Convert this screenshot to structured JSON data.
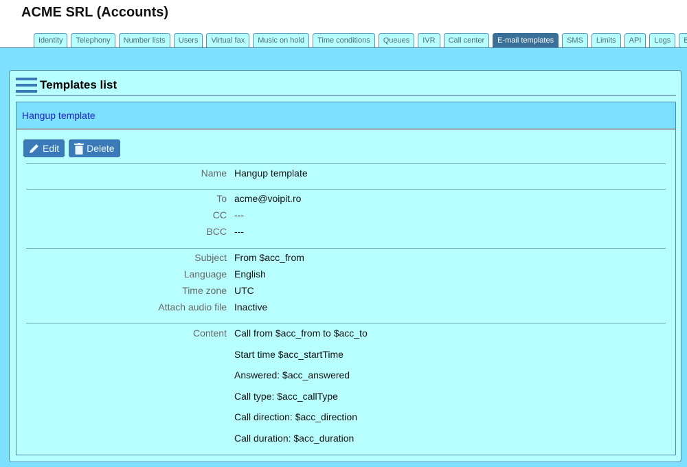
{
  "title": "ACME SRL (Accounts)",
  "tabs": [
    "Identity",
    "Telephony",
    "Number lists",
    "Users",
    "Virtual fax",
    "Music on hold",
    "Time conditions",
    "Queues",
    "IVR",
    "Call center",
    "E-mail templates",
    "SMS",
    "Limits",
    "API",
    "Logs",
    "Billing"
  ],
  "active_tab": "E-mail templates",
  "panel": {
    "title": "Templates list",
    "menu_icon": "hamburger-icon",
    "item": "Hangup template",
    "edit_label": "Edit",
    "delete_label": "Delete"
  },
  "fields": [
    {
      "label": "Name",
      "value": "Hangup template"
    },
    {
      "label": "To",
      "value": "acme@voipit.ro"
    },
    {
      "label": "CC",
      "value": "---"
    },
    {
      "label": "BCC",
      "value": "---"
    },
    {
      "label": "Subject",
      "value": "From $acc_from"
    },
    {
      "label": "Language",
      "value": "English"
    },
    {
      "label": "Time zone",
      "value": "UTC"
    },
    {
      "label": "Attach audio file",
      "value": "Inactive"
    }
  ],
  "content_label": "Content",
  "content": [
    "Call from $acc_from to $acc_to",
    "Start time $acc_startTime",
    "Answered: $acc_answered",
    "Call type: $acc_callType",
    "Call direction: $acc_direction",
    "Call duration: $acc_duration"
  ],
  "colors": {
    "background": "#7de0fd",
    "panel": "#b8ffff",
    "accent": "#3a7ab8",
    "link": "#2222dd"
  }
}
